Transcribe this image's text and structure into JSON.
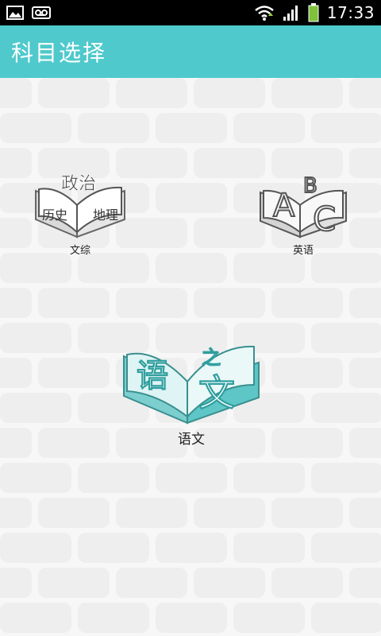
{
  "status_bar": {
    "time": "17:33",
    "icons": [
      "gallery-icon",
      "voicemail-icon",
      "wifi-icon",
      "signal-icon",
      "battery-icon"
    ]
  },
  "app_bar": {
    "title": "科目选择",
    "color": "#4fc9cc"
  },
  "subjects": {
    "wenzong": {
      "label": "文综",
      "book_words": [
        "政治",
        "历史",
        "地理"
      ]
    },
    "english": {
      "label": "英语",
      "book_letters": [
        "A",
        "B",
        "C"
      ]
    },
    "chinese": {
      "label": "语文",
      "book_chars": [
        "语",
        "之",
        "文"
      ],
      "accent": "#5ec6c6"
    }
  }
}
